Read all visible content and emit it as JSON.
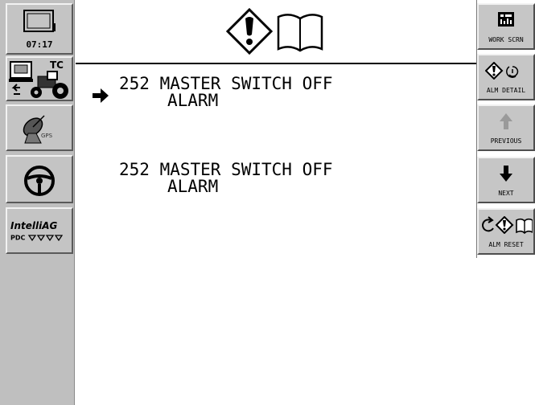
{
  "sidebar": {
    "clock": "07:17",
    "tc_label": "TC",
    "gps_label": "GPS",
    "intellag_brand": "IntelliAG",
    "intellag_sub": "PDC"
  },
  "header": {
    "icons": [
      "alarm-icon",
      "book-icon"
    ]
  },
  "alarms": [
    {
      "code": "252",
      "text_line1": "MASTER SWITCH OFF",
      "text_line2": "ALARM",
      "selected": true
    },
    {
      "code": "252",
      "text_line1": "MASTER SWITCH OFF",
      "text_line2": "ALARM",
      "selected": false
    }
  ],
  "buttons": {
    "work_screen": "WORK SCRN",
    "alarm_detail": "ALM DETAIL",
    "previous": "PREVIOUS",
    "next": "NEXT",
    "alarm_reset": "ALM RESET"
  },
  "colors": {
    "panel": "#c4c4c4",
    "background": "#ffffff",
    "disabled": "#9a9a9a"
  }
}
